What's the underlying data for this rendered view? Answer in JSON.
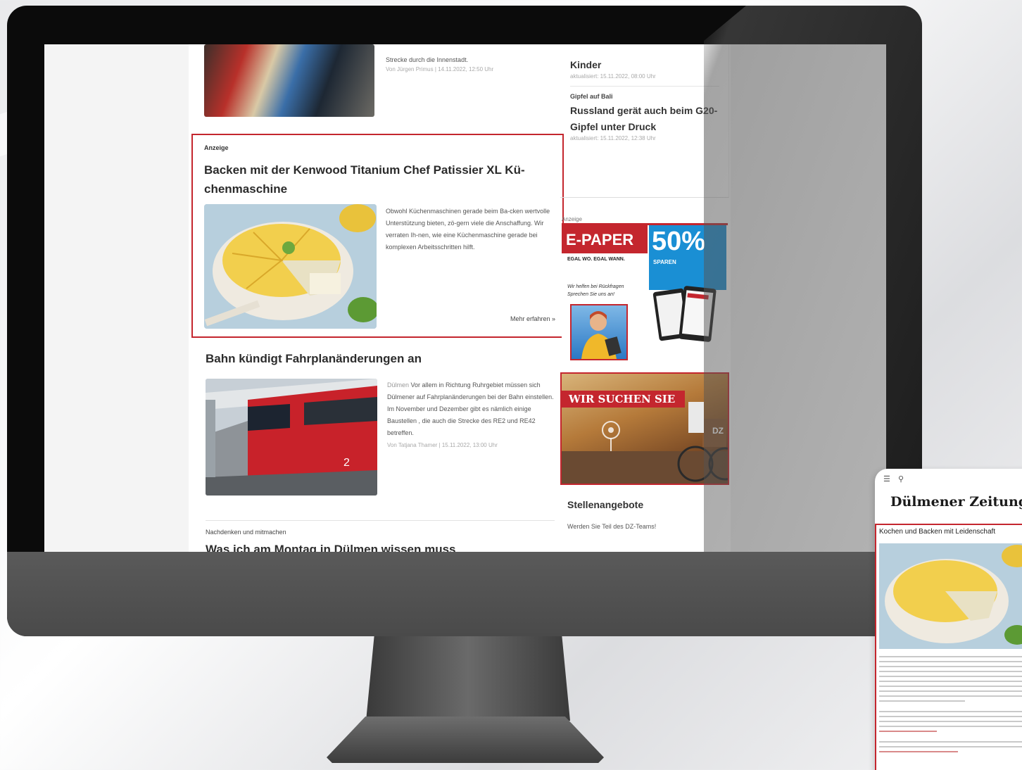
{
  "article_top": {
    "text": "Strecke durch die Innenstadt.",
    "meta": "Von Jürgen Primus | 14.11.2022, 12:50 Uhr"
  },
  "ad": {
    "label": "Anzeige",
    "title": "Backen mit der Kenwood Titanium Chef Patissier XL Kü-chenmaschine",
    "text": "Obwohl Küchenmaschinen gerade beim Ba-cken wertvolle Unterstützung bieten, zö-gern viele die Anschaffung. Wir verraten Ih-nen, wie eine Küchenmaschine gerade bei komplexen Arbeitsschritten hilft.",
    "more": "Mehr erfahren »"
  },
  "article": {
    "title": "Bahn kündigt Fahrplanänderungen an",
    "location": "Dülmen",
    "text": "Vor allem in Richtung Ruhrgebiet müssen sich Dülmener auf Fahrplanänderungen bei der Bahn einstellen. Im November und Dezember gibt es nämlich einige Baustellen , die auch die Strecke des RE2 und RE42 betreffen.",
    "meta": "Von Tatjana Thamer | 15.11.2022, 13:00 Uhr"
  },
  "bottom": {
    "kicker": "Nachdenken und mitmachen",
    "title": "Was ich am Montag in Dülmen wissen muss"
  },
  "sidebar": {
    "item1_title": "Kinder",
    "item1_meta": "aktualisiert: 15.11.2022, 08:00 Uhr",
    "item2_kicker": "Gipfel auf Bali",
    "item2_title": "Russland gerät auch beim G20-Gipfel unter Druck",
    "item2_meta": "aktualisiert: 15.11.2022, 12:38 Uhr"
  },
  "epaper": {
    "label": "Anzeige",
    "head": "E-PAPER",
    "percent": "50%",
    "sub": "SPAREN",
    "tag": "EGAL WO. EGAL WANN.",
    "script": "Wir helfen bei Rückfragen Sprechen Sie uns an!"
  },
  "jobs": {
    "banner": "WIR SUCHEN SIE",
    "badge": "DZ",
    "title": "Stellenangebote",
    "sub": "Werden Sie Teil des DZ-Teams!"
  },
  "phone": {
    "logo": "Dülmener Zeitung",
    "headline": "Kochen und Backen mit Leidenschaft"
  },
  "colors": {
    "accent_red": "#c4262e",
    "epaper_blue": "#1a8fd4"
  }
}
